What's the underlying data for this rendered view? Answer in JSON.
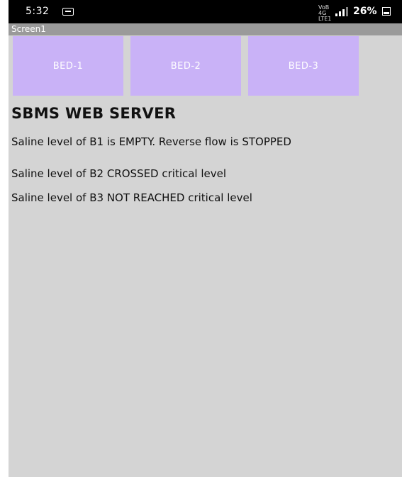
{
  "status_bar": {
    "time": "5:32",
    "message_icon": "message-icon",
    "network_label": "VoB 4G LTE1",
    "signal_icon": "signal-icon",
    "battery_percent": "26%",
    "battery_icon": "battery-icon"
  },
  "app": {
    "screen_title": "Screen1"
  },
  "beds": [
    {
      "label": "BED-1"
    },
    {
      "label": "BED-2"
    },
    {
      "label": "BED-3"
    }
  ],
  "main": {
    "title": "SBMS WEB SERVER",
    "status_lines": [
      "Saline level of B1 is EMPTY. Reverse flow is STOPPED",
      "Saline level of B2 CROSSED critical level",
      "Saline level of B3 NOT REACHED critical level"
    ]
  },
  "colors": {
    "bed_button": "#c9b2f7",
    "background": "#d4d4d4",
    "title_bar": "#9a9a9a"
  }
}
